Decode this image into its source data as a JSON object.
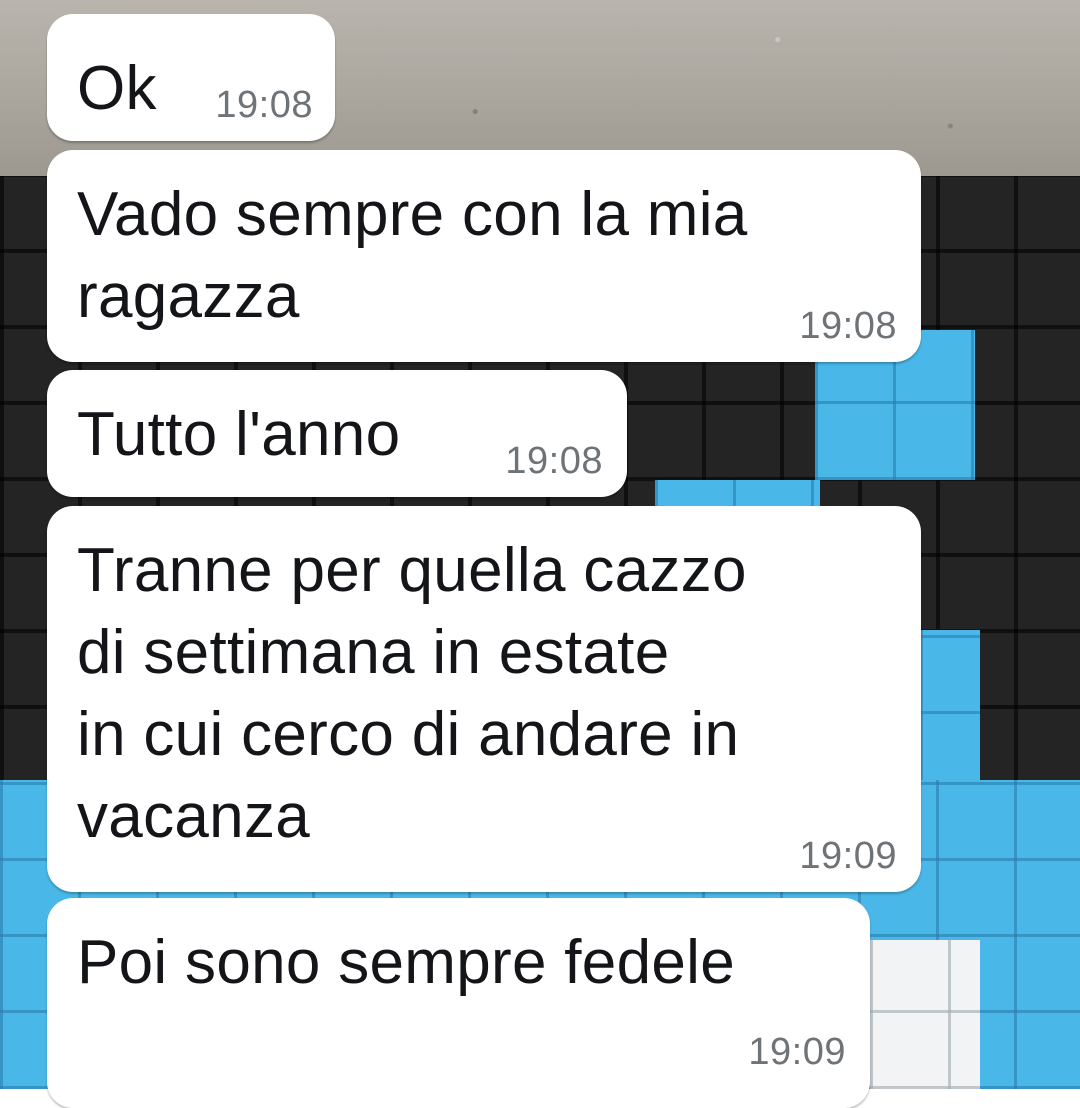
{
  "messages": [
    {
      "text": "Ok",
      "time": "19:08"
    },
    {
      "text": "Vado sempre con la mia\nragazza",
      "time": "19:08"
    },
    {
      "text": "Tutto l'anno",
      "time": "19:08"
    },
    {
      "text": "Tranne per quella cazzo\ndi settimana in estate\nin cui cerco di andare in\nvacanza",
      "time": "19:09"
    },
    {
      "text": "Poi sono sempre fedele",
      "time": "19:09"
    }
  ],
  "colors": {
    "bubble": "#ffffff",
    "message_text": "#131518",
    "timestamp": "#6e7378",
    "wallpaper_blue": "#49b8e9",
    "wallpaper_dark": "#242424"
  }
}
